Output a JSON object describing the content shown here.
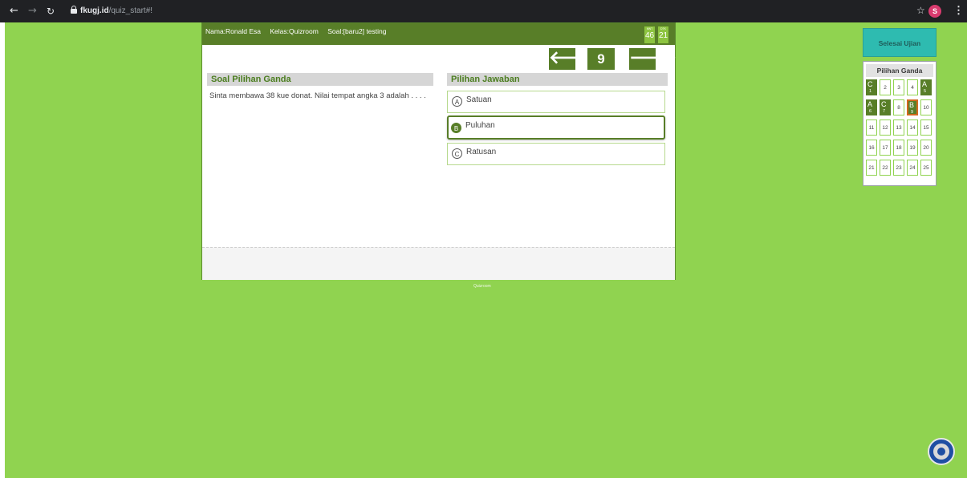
{
  "browser": {
    "url_domain": "fkugj.id",
    "url_path": "/quiz_start#!",
    "profile_initial": "S"
  },
  "header": {
    "name_text": "Nama:Ronald Esa",
    "class_text": "Kelas:Quizroom",
    "question_set_text": "Soal:[baru2] testing",
    "timer": [
      {
        "label": "MNT",
        "value": "46"
      },
      {
        "label": "DTK",
        "value": "21"
      }
    ]
  },
  "navigation": {
    "current_number": "9"
  },
  "question": {
    "section_title": "Soal Pilihan Ganda",
    "text": "Sinta membawa 38 kue donat. Nilai tempat angka 3 adalah . . . ."
  },
  "answers": {
    "section_title": "Pilihan Jawaban",
    "options": [
      {
        "letter": "A",
        "text": "Satuan"
      },
      {
        "letter": "B",
        "text": "Puluhan"
      },
      {
        "letter": "C",
        "text": "Ratusan"
      }
    ]
  },
  "footer": {
    "label": "Quizroom"
  },
  "sidebar": {
    "finish_label": "Selesai Ujian",
    "panel_title": "Pilihan Ganda",
    "cells": [
      {
        "number": "1",
        "answer": "C"
      },
      {
        "number": "2",
        "answer": ""
      },
      {
        "number": "3",
        "answer": ""
      },
      {
        "number": "4",
        "answer": ""
      },
      {
        "number": "5",
        "answer": "A"
      },
      {
        "number": "6",
        "answer": "A"
      },
      {
        "number": "7",
        "answer": "C"
      },
      {
        "number": "8",
        "answer": ""
      },
      {
        "number": "9",
        "answer": "B"
      },
      {
        "number": "10",
        "answer": ""
      },
      {
        "number": "11",
        "answer": ""
      },
      {
        "number": "12",
        "answer": ""
      },
      {
        "number": "13",
        "answer": ""
      },
      {
        "number": "14",
        "answer": ""
      },
      {
        "number": "15",
        "answer": ""
      },
      {
        "number": "16",
        "answer": ""
      },
      {
        "number": "17",
        "answer": ""
      },
      {
        "number": "18",
        "answer": ""
      },
      {
        "number": "19",
        "answer": ""
      },
      {
        "number": "20",
        "answer": ""
      },
      {
        "number": "21",
        "answer": ""
      },
      {
        "number": "22",
        "answer": ""
      },
      {
        "number": "23",
        "answer": ""
      },
      {
        "number": "24",
        "answer": ""
      },
      {
        "number": "25",
        "answer": ""
      }
    ]
  },
  "icons": {
    "back": "arrow-left-icon",
    "forward": "arrow-right-icon",
    "reload": "reload-icon",
    "lock": "lock-icon",
    "bookmark": "star-icon",
    "menu": "kebab-menu-icon",
    "emblem": "university-emblem"
  },
  "colors": {
    "page_background": "#90d350",
    "header_green": "#587e28",
    "finish_button": "#2ebbb0",
    "current_question_border": "#d2691e",
    "browser_bar": "#202124"
  }
}
